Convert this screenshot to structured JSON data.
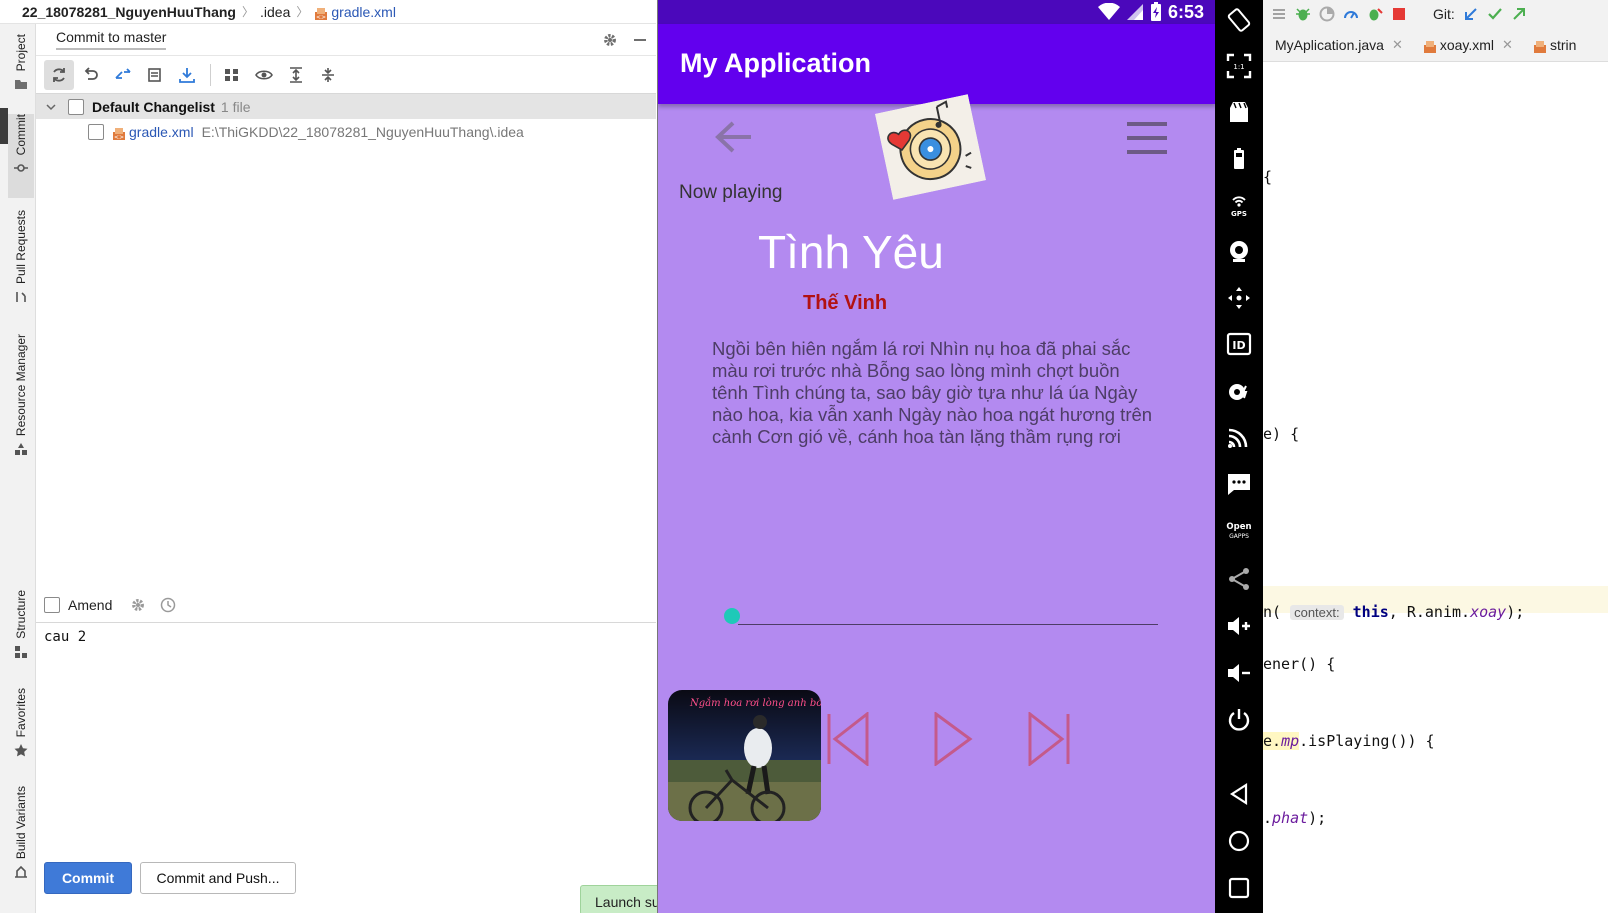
{
  "ide": {
    "breadcrumb": {
      "project": "22_18078281_NguyenHuuThang",
      "folder": ".idea",
      "file": "gradle.xml"
    },
    "tool_tabs": {
      "project": "Project",
      "commit": "Commit",
      "pull_requests": "Pull Requests",
      "resource_manager": "Resource Manager",
      "structure": "Structure",
      "favorites": "Favorites",
      "build_variants": "Build Variants"
    },
    "commit_panel": {
      "title": "Commit to master",
      "changelist_name": "Default Changelist",
      "changelist_count": "1 file",
      "file_name": "gradle.xml",
      "file_path": "E:\\ThiGKDD\\22_18078281_NguyenHuuThang\\.idea",
      "amend_label": "Amend",
      "commit_message": "cau 2",
      "commit_button": "Commit",
      "commit_push_button": "Commit and Push...",
      "launch_toast": "Launch su"
    }
  },
  "phone": {
    "status_time": "6:53",
    "app_title": "My Application",
    "now_playing": "Now playing",
    "song_title": "Tình Yêu",
    "artist": "Thế Vinh",
    "lyrics": "Ngồi bên hiên ngắm lá rơi Nhìn nụ hoa đã phai sắc màu rơi trước nhà Bỗng sao lòng mình chợt buồn tênh Tình chúng ta, sao bây giờ tựa như lá úa Ngày nào hoa, kia vẫn xanh Ngày nào hoa ngát hương trên cành Cơn gió về, cánh hoa tàn lặng thầm rụng rơi",
    "cover_caption": "Ngắm hoa rơi lòng anh bồng",
    "seek_progress": 0,
    "colors": {
      "status_bar": "#4b08bb",
      "app_bar": "#6200ee",
      "background": "#b38af0",
      "artist": "#b21212",
      "seek_thumb": "#1ec9b8"
    }
  },
  "emulator_sidebar": {
    "icons": [
      "rotate-icon",
      "fullscreen-icon",
      "screenshot-icon",
      "battery-icon",
      "gps-icon",
      "camera-icon",
      "dpad-icon",
      "id-icon",
      "fingerprint-icon",
      "cast-icon",
      "message-icon",
      "opengapps-icon",
      "share-icon",
      "volume-up-icon",
      "volume-down-icon",
      "power-icon",
      "back-icon",
      "home-icon",
      "overview-icon"
    ],
    "gps_label": "GPS",
    "id_label": "ID",
    "opengapps_label": "Open GAPPS"
  },
  "editor": {
    "toolbar_git": "Git:",
    "tabs": [
      "MyAplication.java",
      "xoay.xml",
      "strin"
    ],
    "lines": {
      "l1": "{",
      "l2": "e) {",
      "l3_prefix": "n(",
      "l3_hint": "context:",
      "l3_this": "this",
      "l3_mid": ", R.anim.",
      "l3_italic": "xoay",
      "l3_end": ");",
      "l4": "ener() {",
      "l5_a": "e.",
      "l5_b": "mp",
      "l5_c": ".isPlaying()) {",
      "l6_a": ".",
      "l6_b": "phat",
      "l6_c": ");"
    }
  }
}
